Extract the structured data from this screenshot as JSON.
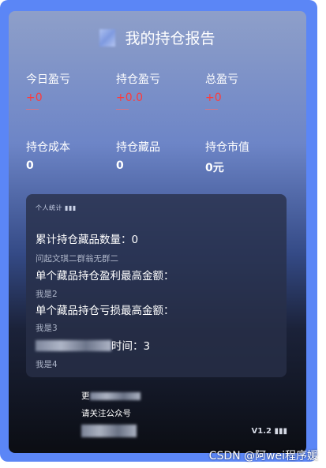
{
  "report": {
    "title": "我的持仓报告"
  },
  "stats_top": [
    {
      "label": "今日盈亏",
      "value": "+0"
    },
    {
      "label": "持仓盈亏",
      "value": "+0.0"
    },
    {
      "label": "总盈亏",
      "value": "+0"
    }
  ],
  "stats_bottom": [
    {
      "label": "持仓成本",
      "value": "0"
    },
    {
      "label": "持仓藏品",
      "value": "0"
    },
    {
      "label": "持仓市值",
      "value": "0元"
    }
  ],
  "panel": {
    "tag": "个人统计 ▮▮▮",
    "line1": "累计持仓藏品数量：0",
    "line1_sub": "问起文琪二群翁无群二",
    "line2": "单个藏品持仓盈利最高金额：",
    "line2_sub": "我是2",
    "line3": "单个藏品持仓亏损最高金额：",
    "line3_sub": "我是3",
    "line4_suffix": "时间：3",
    "line4_sub": "我是4"
  },
  "footer": {
    "line1_prefix": "更",
    "line2": "请关注公众号",
    "version": "V1.2 ▮▮▮"
  },
  "watermark": "CSDN @阿wei程序媛",
  "colors": {
    "frame": "#5b86f6",
    "positive": "#ff3b3b"
  }
}
